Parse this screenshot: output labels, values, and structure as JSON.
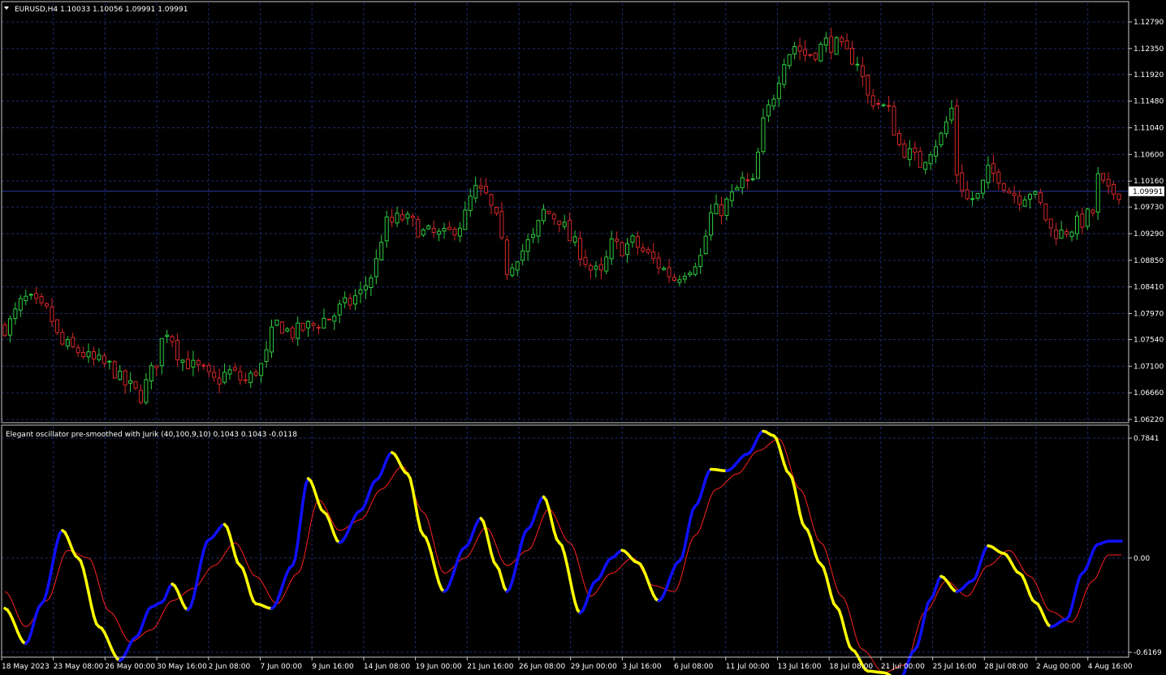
{
  "colors": {
    "background": "#000000",
    "grid": "#1e2a6e",
    "frame": "#c8c8c8",
    "text": "#ffffff",
    "bull_candle": "#2ecc40",
    "bear_candle": "#d62728",
    "bid_line": "#2a3aa0",
    "osc_up": "#1010ff",
    "osc_down": "#ffff00",
    "signal": "#ff2020"
  },
  "price_panel": {
    "header": "EURUSD,H4  1.10033 1.10056 1.09991 1.09991",
    "current_price": "1.09991",
    "current_value": 1.09991,
    "y_ticks": [
      "1.12790",
      "1.12350",
      "1.11920",
      "1.11480",
      "1.11040",
      "1.10600",
      "1.10160",
      "1.09730",
      "1.09290",
      "1.08850",
      "1.08410",
      "1.07970",
      "1.07540",
      "1.07100",
      "1.06660",
      "1.06220"
    ],
    "y_range": [
      1.0622,
      1.1279
    ]
  },
  "indicator_panel": {
    "header": "Elegant oscillator pre-smoothed with Jurik (40,100,9,10) 0.1043 0.1043 -0.0118",
    "y_ticks": [
      "0.7841",
      "0.00",
      "-0.6169"
    ],
    "y_range": [
      -0.6169,
      0.7841
    ]
  },
  "x_labels": [
    "18 May 2023",
    "23 May 08:00",
    "26 May 00:00",
    "30 May 16:00",
    "2 Jun 08:00",
    "7 Jun 00:00",
    "9 Jun 16:00",
    "14 Jun 08:00",
    "19 Jun 00:00",
    "21 Jun 16:00",
    "26 Jun 08:00",
    "29 Jun 00:00",
    "3 Jul 16:00",
    "6 Jul 08:00",
    "11 Jul 00:00",
    "13 Jul 16:00",
    "18 Jul 08:00",
    "21 Jul 00:00",
    "25 Jul 16:00",
    "28 Jul 08:00",
    "2 Aug 00:00",
    "4 Aug 16:00"
  ],
  "chart_data": [
    {
      "type": "candlestick",
      "title": "EURUSD,H4",
      "ylim": [
        1.0622,
        1.1279
      ],
      "grid": true,
      "close_path": [
        [
          0,
          1.0775
        ],
        [
          4,
          1.082
        ],
        [
          8,
          1.08
        ],
        [
          11,
          1.0745
        ],
        [
          14,
          1.0735
        ],
        [
          17,
          1.0718
        ],
        [
          20,
          1.071
        ],
        [
          23,
          1.068
        ],
        [
          26,
          1.0662
        ],
        [
          28,
          1.07
        ],
        [
          31,
          1.077
        ],
        [
          34,
          1.072
        ],
        [
          37,
          1.0705
        ],
        [
          40,
          1.0685
        ],
        [
          43,
          1.07
        ],
        [
          46,
          1.0685
        ],
        [
          49,
          1.071
        ],
        [
          52,
          1.078
        ],
        [
          55,
          1.0765
        ],
        [
          58,
          1.0775
        ],
        [
          62,
          1.079
        ],
        [
          65,
          1.081
        ],
        [
          68,
          1.083
        ],
        [
          70,
          1.086
        ],
        [
          73,
          1.0945
        ],
        [
          76,
          1.0955
        ],
        [
          78,
          1.0945
        ],
        [
          80,
          1.093
        ],
        [
          84,
          1.0925
        ],
        [
          87,
          1.0945
        ],
        [
          90,
          1.1
        ],
        [
          92,
          1.099
        ],
        [
          94,
          1.095
        ],
        [
          96,
          1.087
        ],
        [
          98,
          1.0895
        ],
        [
          101,
          1.092
        ],
        [
          103,
          1.0965
        ],
        [
          106,
          1.0955
        ],
        [
          108,
          1.092
        ],
        [
          110,
          1.09
        ],
        [
          112,
          1.087
        ],
        [
          114,
          1.086
        ],
        [
          116,
          1.091
        ],
        [
          118,
          1.0905
        ],
        [
          120,
          1.0915
        ],
        [
          122,
          1.09
        ],
        [
          124,
          1.0885
        ],
        [
          126,
          1.087
        ],
        [
          128,
          1.0855
        ],
        [
          130,
          1.087
        ],
        [
          133,
          1.089
        ],
        [
          135,
          1.096
        ],
        [
          137,
          1.097
        ],
        [
          139,
          1.099
        ],
        [
          141,
          1.1015
        ],
        [
          143,
          1.101
        ],
        [
          145,
          1.111
        ],
        [
          147,
          1.116
        ],
        [
          149,
          1.122
        ],
        [
          151,
          1.124
        ],
        [
          153,
          1.1225
        ],
        [
          155,
          1.123
        ],
        [
          157,
          1.1245
        ],
        [
          159,
          1.124
        ],
        [
          161,
          1.1225
        ],
        [
          163,
          1.1215
        ],
        [
          165,
          1.1155
        ],
        [
          167,
          1.1145
        ],
        [
          169,
          1.113
        ],
        [
          171,
          1.1075
        ],
        [
          173,
          1.106
        ],
        [
          175,
          1.1045
        ],
        [
          177,
          1.107
        ],
        [
          179,
          1.109
        ],
        [
          181,
          1.1135
        ],
        [
          182,
          1.103
        ],
        [
          184,
          1.0985
        ],
        [
          186,
          1.099
        ],
        [
          188,
          1.103
        ],
        [
          190,
          1.1025
        ],
        [
          192,
          1.1
        ],
        [
          194,
          1.099
        ],
        [
          196,
          1.1
        ],
        [
          198,
          1.0975
        ],
        [
          200,
          1.0935
        ],
        [
          202,
          1.093
        ],
        [
          204,
          1.094
        ],
        [
          206,
          1.095
        ],
        [
          208,
          1.0965
        ],
        [
          209,
          1.102
        ],
        [
          211,
          1.0995
        ],
        [
          213,
          1.0999
        ]
      ],
      "indicator": {
        "type": "line",
        "name": "Elegant oscillator pre-smoothed with Jurik (40,100,9,10)",
        "ylim": [
          -0.6169,
          0.7841
        ],
        "oscillator": [
          [
            0,
            -0.33
          ],
          [
            4,
            -0.56
          ],
          [
            7,
            -0.3
          ],
          [
            11,
            0.18
          ],
          [
            14,
            0.0
          ],
          [
            18,
            -0.45
          ],
          [
            22,
            -0.67
          ],
          [
            25,
            -0.52
          ],
          [
            28,
            -0.32
          ],
          [
            30,
            -0.29
          ],
          [
            32,
            -0.17
          ],
          [
            35,
            -0.34
          ],
          [
            39,
            0.12
          ],
          [
            42,
            0.22
          ],
          [
            45,
            -0.05
          ],
          [
            48,
            -0.3
          ],
          [
            51,
            -0.33
          ],
          [
            55,
            -0.05
          ],
          [
            58,
            0.52
          ],
          [
            61,
            0.3
          ],
          [
            64,
            0.1
          ],
          [
            68,
            0.31
          ],
          [
            71,
            0.51
          ],
          [
            74,
            0.69
          ],
          [
            77,
            0.55
          ],
          [
            80,
            0.15
          ],
          [
            84,
            -0.22
          ],
          [
            88,
            0.07
          ],
          [
            91,
            0.26
          ],
          [
            94,
            -0.05
          ],
          [
            96,
            -0.22
          ],
          [
            100,
            0.19
          ],
          [
            103,
            0.4
          ],
          [
            106,
            0.1
          ],
          [
            110,
            -0.36
          ],
          [
            113,
            -0.15
          ],
          [
            116,
            0.0
          ],
          [
            118,
            0.05
          ],
          [
            121,
            -0.03
          ],
          [
            125,
            -0.28
          ],
          [
            129,
            -0.02
          ],
          [
            132,
            0.34
          ],
          [
            135,
            0.58
          ],
          [
            138,
            0.57
          ],
          [
            142,
            0.68
          ],
          [
            145,
            0.83
          ],
          [
            147,
            0.8
          ],
          [
            150,
            0.55
          ],
          [
            153,
            0.2
          ],
          [
            156,
            -0.04
          ],
          [
            159,
            -0.32
          ],
          [
            162,
            -0.6
          ],
          [
            165,
            -0.74
          ],
          [
            168,
            -0.75
          ],
          [
            171,
            -0.8
          ],
          [
            174,
            -0.6
          ],
          [
            177,
            -0.27
          ],
          [
            179,
            -0.12
          ],
          [
            182,
            -0.22
          ],
          [
            185,
            -0.15
          ],
          [
            188,
            0.08
          ],
          [
            191,
            0.03
          ],
          [
            194,
            -0.1
          ],
          [
            197,
            -0.29
          ],
          [
            200,
            -0.45
          ],
          [
            203,
            -0.4
          ],
          [
            206,
            -0.1
          ],
          [
            209,
            0.09
          ],
          [
            211,
            0.11
          ]
        ],
        "signal": [
          [
            0,
            -0.22
          ],
          [
            4,
            -0.45
          ],
          [
            8,
            -0.28
          ],
          [
            12,
            0.05
          ],
          [
            16,
            0.0
          ],
          [
            20,
            -0.35
          ],
          [
            24,
            -0.55
          ],
          [
            28,
            -0.47
          ],
          [
            32,
            -0.28
          ],
          [
            36,
            -0.2
          ],
          [
            40,
            -0.05
          ],
          [
            44,
            0.1
          ],
          [
            48,
            -0.12
          ],
          [
            52,
            -0.3
          ],
          [
            56,
            -0.1
          ],
          [
            60,
            0.38
          ],
          [
            64,
            0.18
          ],
          [
            68,
            0.25
          ],
          [
            72,
            0.45
          ],
          [
            76,
            0.6
          ],
          [
            80,
            0.3
          ],
          [
            84,
            -0.1
          ],
          [
            88,
            0.0
          ],
          [
            92,
            0.2
          ],
          [
            96,
            -0.05
          ],
          [
            100,
            0.05
          ],
          [
            104,
            0.32
          ],
          [
            108,
            0.1
          ],
          [
            112,
            -0.25
          ],
          [
            116,
            -0.1
          ],
          [
            120,
            0.0
          ],
          [
            124,
            -0.18
          ],
          [
            128,
            -0.22
          ],
          [
            132,
            0.15
          ],
          [
            136,
            0.45
          ],
          [
            140,
            0.55
          ],
          [
            144,
            0.7
          ],
          [
            148,
            0.78
          ],
          [
            152,
            0.45
          ],
          [
            156,
            0.1
          ],
          [
            160,
            -0.25
          ],
          [
            164,
            -0.6
          ],
          [
            168,
            -0.75
          ],
          [
            172,
            -0.7
          ],
          [
            176,
            -0.35
          ],
          [
            180,
            -0.15
          ],
          [
            184,
            -0.25
          ],
          [
            188,
            -0.05
          ],
          [
            192,
            0.05
          ],
          [
            196,
            -0.12
          ],
          [
            200,
            -0.35
          ],
          [
            204,
            -0.42
          ],
          [
            208,
            -0.15
          ],
          [
            211,
            0.02
          ]
        ]
      }
    }
  ]
}
